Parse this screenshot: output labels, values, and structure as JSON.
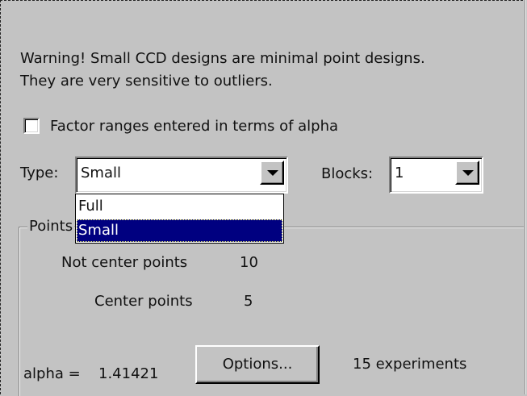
{
  "warning": {
    "line1": "Warning!  Small CCD designs are minimal point designs.",
    "line2": "They are very sensitive to outliers."
  },
  "alpha_checkbox": {
    "label": "Factor ranges entered in terms of alpha",
    "checked": false
  },
  "type": {
    "label": "Type:",
    "value": "Small",
    "options": [
      "Full",
      "Small"
    ],
    "highlighted": "Small"
  },
  "blocks": {
    "label": "Blocks:",
    "value": "1"
  },
  "points": {
    "group_label": "Points",
    "not_center_label": "Not center points",
    "not_center_value": "10",
    "center_label": "Center points",
    "center_value": "5"
  },
  "alpha": {
    "label": "alpha =",
    "value": "1.41421"
  },
  "options_button": {
    "label": "Options..."
  },
  "experiments": {
    "text": "15 experiments"
  },
  "colors": {
    "dialog_bg": "#c3c3c3",
    "selection_bg": "#000080",
    "selection_fg": "#ffffff"
  }
}
